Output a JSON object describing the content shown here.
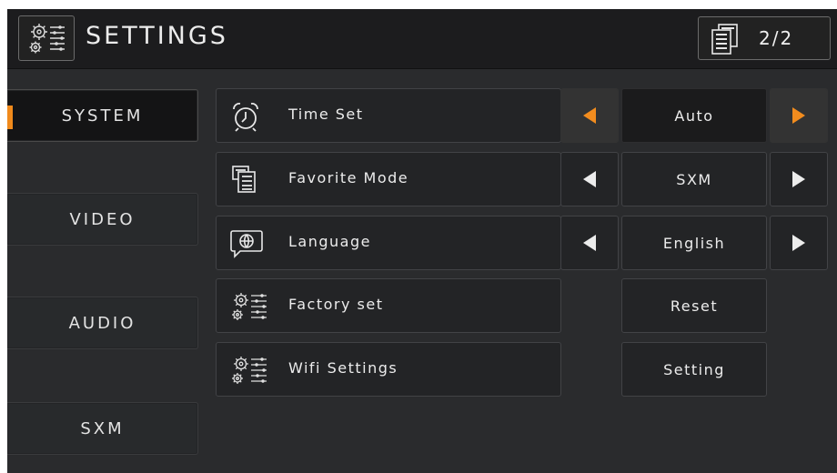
{
  "header": {
    "title": "SETTINGS",
    "page_indicator": "2/2"
  },
  "tabs": [
    {
      "label": "SYSTEM",
      "active": true
    },
    {
      "label": "VIDEO",
      "active": false
    },
    {
      "label": "AUDIO",
      "active": false
    },
    {
      "label": "SXM",
      "active": false
    }
  ],
  "settings": [
    {
      "label": "Time Set",
      "icon": "alarm-clock-icon",
      "value": "Auto"
    },
    {
      "label": "Favorite Mode",
      "icon": "favorite-docs-icon",
      "value": "SXM"
    },
    {
      "label": "Language",
      "icon": "globe-chat-icon",
      "value": "English"
    },
    {
      "label": "Factory set",
      "icon": "gears-sliders-icon",
      "button": "Reset"
    },
    {
      "label": "Wifi Settings",
      "icon": "gears-sliders-icon",
      "button": "Setting"
    }
  ],
  "colors": {
    "accent": "#f08a1c",
    "background": "#2a2b2d",
    "header": "#1c1c1e"
  }
}
